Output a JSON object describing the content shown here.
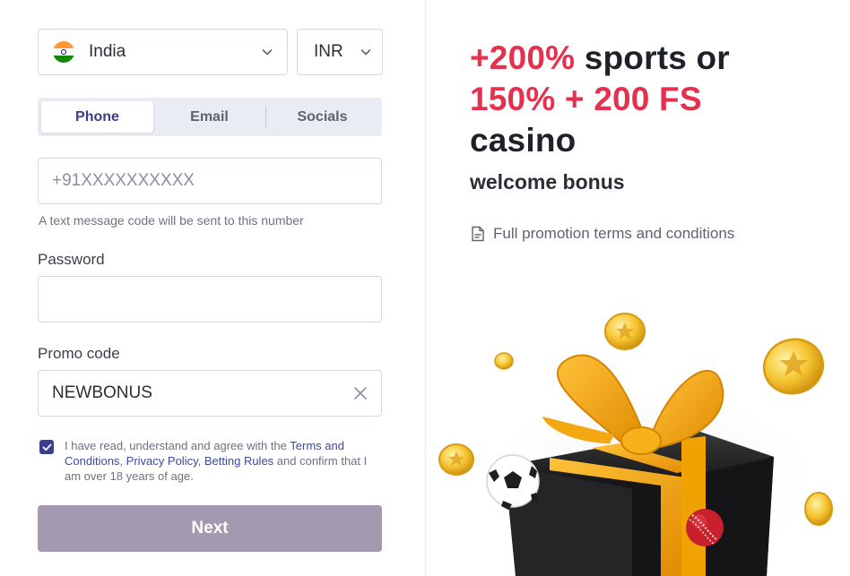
{
  "form": {
    "country": {
      "value": "India",
      "icon": "india-flag-icon"
    },
    "currency": {
      "value": "INR"
    },
    "tabs": [
      {
        "label": "Phone",
        "active": true
      },
      {
        "label": "Email",
        "active": false
      },
      {
        "label": "Socials",
        "active": false
      }
    ],
    "phone": {
      "placeholder": "+91XXXXXXXXXX",
      "value": ""
    },
    "phone_hint": "A text message code will be sent to this number",
    "password": {
      "label": "Password",
      "value": ""
    },
    "promo": {
      "label": "Promo code",
      "value": "NEWBONUS"
    },
    "agreement": {
      "checked": true,
      "text_before": "I have read, understand and agree with the ",
      "link_terms": "Terms and Conditions",
      "sep1": ", ",
      "link_privacy": "Privacy Policy",
      "sep2": ", ",
      "link_rules": "Betting Rules",
      "text_after": " and confirm that I am over 18 years of age."
    },
    "next_label": "Next"
  },
  "promo": {
    "headline_part1": "+200%",
    "headline_part2": " sports or ",
    "headline_part3": "150% + 200 FS",
    "headline_part4": "casino",
    "subhead": "welcome bonus",
    "terms_link": "Full promotion terms and conditions"
  },
  "colors": {
    "accent": "#3c3d8f",
    "highlight": "#e5314e",
    "next_button": "#a399b1",
    "tab_bg": "#e9edf3"
  }
}
